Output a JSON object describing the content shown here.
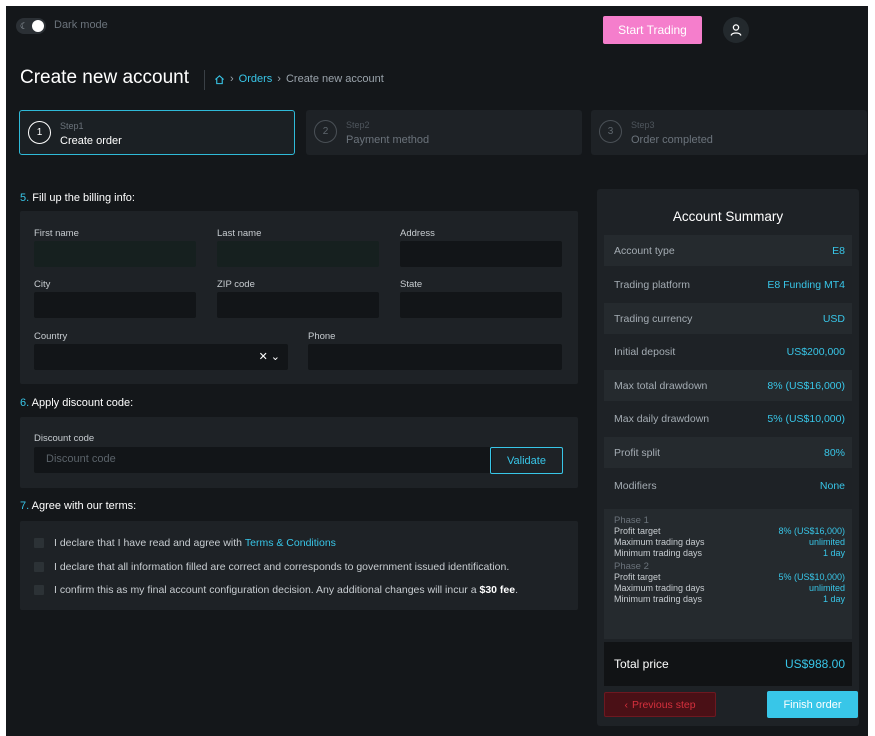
{
  "header": {
    "dark_mode_label": "Dark mode",
    "start_trading": "Start Trading"
  },
  "page": {
    "title": "Create new account",
    "breadcrumb": {
      "orders": "Orders",
      "current": "Create new account",
      "separator": ">"
    }
  },
  "steps": [
    {
      "num": "1",
      "small": "Step1",
      "label": "Create order",
      "active": true
    },
    {
      "num": "2",
      "small": "Step2",
      "label": "Payment method",
      "active": false
    },
    {
      "num": "3",
      "small": "Step3",
      "label": "Order completed",
      "active": false
    }
  ],
  "billing": {
    "num": "5.",
    "title": "Fill up the billing info:",
    "first_name": "First name",
    "last_name": "Last name",
    "address": "Address",
    "city": "City",
    "zip": "ZIP code",
    "state": "State",
    "country": "Country",
    "phone": "Phone",
    "country_value": ""
  },
  "discount": {
    "num": "6.",
    "title": "Apply discount code:",
    "label": "Discount code",
    "placeholder": "Discount code",
    "validate": "Validate"
  },
  "terms": {
    "num": "7.",
    "title": "Agree with our terms:",
    "line1_prefix": "I declare that I have read and agree with ",
    "line1_link": "Terms & Conditions",
    "line2": "I declare that all information filled are correct and corresponds to government issued identification.",
    "line3_prefix": "I confirm this as my final account configuration decision. Any additional changes will incur a ",
    "line3_fee": "$30 fee",
    "line3_suffix": "."
  },
  "summary": {
    "title": "Account Summary",
    "rows": [
      {
        "k": "Account type",
        "v": "E8"
      },
      {
        "k": "Trading platform",
        "v": "E8 Funding MT4"
      },
      {
        "k": "Trading currency",
        "v": "USD"
      },
      {
        "k": "Initial deposit",
        "v": "US$200,000"
      },
      {
        "k": "Max total drawdown",
        "v": "8% (US$16,000)"
      },
      {
        "k": "Max daily drawdown",
        "v": "5% (US$10,000)"
      },
      {
        "k": "Profit split",
        "v": "80%"
      },
      {
        "k": "Modifiers",
        "v": "None"
      }
    ],
    "phases": [
      {
        "name": "Phase 1",
        "rows": [
          {
            "k": "Profit target",
            "v": "8% (US$16,000)"
          },
          {
            "k": "Maximum trading days",
            "v": "unlimited"
          },
          {
            "k": "Minimum trading days",
            "v": "1 day"
          }
        ]
      },
      {
        "name": "Phase 2",
        "rows": [
          {
            "k": "Profit target",
            "v": "5% (US$10,000)"
          },
          {
            "k": "Maximum trading days",
            "v": "unlimited"
          },
          {
            "k": "Minimum trading days",
            "v": "1 day"
          }
        ]
      }
    ],
    "total_label": "Total price",
    "total_value": "US$988.00",
    "prev": "Previous step",
    "finish": "Finish order"
  },
  "colors": {
    "accent": "#38c6e8",
    "pink": "#f57ecc",
    "danger": "#d6303d",
    "bg": "#14171a",
    "panel": "#1e2226"
  },
  "icons": [
    "moon-icon",
    "user-icon",
    "home-icon",
    "chevron-right-icon",
    "clear-icon",
    "chevron-down-icon",
    "chevron-left-icon"
  ]
}
